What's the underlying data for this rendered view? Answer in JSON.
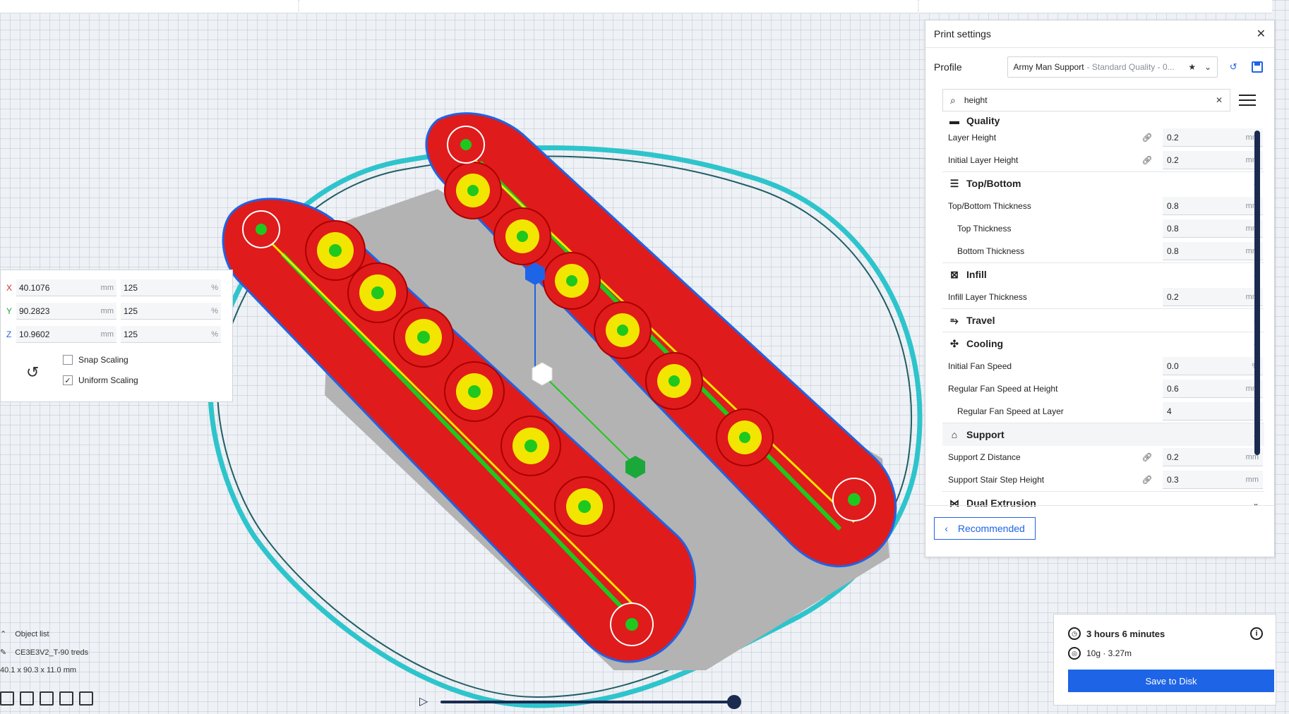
{
  "print_settings": {
    "title": "Print settings",
    "profile_label": "Profile",
    "profile_name": "Army Man Support",
    "profile_detail": "- Standard Quality - 0...",
    "search_value": "height",
    "recommended_label": "Recommended",
    "categories": {
      "quality": "Quality",
      "top_bottom": "Top/Bottom",
      "infill": "Infill",
      "travel": "Travel",
      "cooling": "Cooling",
      "support": "Support",
      "dual_extrusion": "Dual Extrusion"
    },
    "settings": {
      "layer_height": {
        "label": "Layer Height",
        "value": "0.2",
        "unit": "mm"
      },
      "initial_layer_height": {
        "label": "Initial Layer Height",
        "value": "0.2",
        "unit": "mm"
      },
      "top_bottom_thickness": {
        "label": "Top/Bottom Thickness",
        "value": "0.8",
        "unit": "mm"
      },
      "top_thickness": {
        "label": "Top Thickness",
        "value": "0.8",
        "unit": "mm"
      },
      "bottom_thickness": {
        "label": "Bottom Thickness",
        "value": "0.8",
        "unit": "mm"
      },
      "infill_layer_thickness": {
        "label": "Infill Layer Thickness",
        "value": "0.2",
        "unit": "mm"
      },
      "initial_fan_speed": {
        "label": "Initial Fan Speed",
        "value": "0.0",
        "unit": "%"
      },
      "regular_fan_speed_height": {
        "label": "Regular Fan Speed at Height",
        "value": "0.6",
        "unit": "mm"
      },
      "regular_fan_speed_layer": {
        "label": "Regular Fan Speed at Layer",
        "value": "4",
        "unit": ""
      },
      "support_z_distance": {
        "label": "Support Z Distance",
        "value": "0.2",
        "unit": "mm"
      },
      "support_stair_step_height": {
        "label": "Support Stair Step Height",
        "value": "0.3",
        "unit": "mm"
      }
    }
  },
  "scale_tool": {
    "x_label": "X",
    "x_mm": "40.1076",
    "x_pct": "125",
    "y_label": "Y",
    "y_mm": "90.2823",
    "y_pct": "125",
    "z_label": "Z",
    "z_mm": "10.9602",
    "z_pct": "125",
    "unit_mm": "mm",
    "unit_pct": "%",
    "snap_scaling": "Snap Scaling",
    "uniform_scaling": "Uniform Scaling",
    "uniform_checked": "✓"
  },
  "object_list": {
    "title": "Object list",
    "object_name": "CE3E3V2_T-90 treds",
    "dimensions": "40.1 x 90.3 x 11.0 mm"
  },
  "estimate": {
    "time": "3 hours 6 minutes",
    "material": "10g · 3.27m",
    "save_label": "Save to Disk"
  },
  "colors": {
    "accent": "#1e64e6",
    "dark": "#1a2b4f",
    "model_red": "#e01b1b",
    "model_yellow": "#f2e600",
    "model_green": "#1ec81e",
    "skirt_cyan": "#2ec4cc"
  }
}
